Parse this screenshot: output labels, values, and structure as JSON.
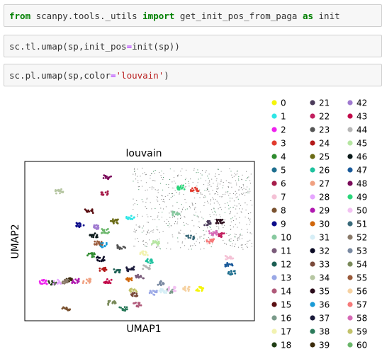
{
  "cells": [
    {
      "id": "cell-1",
      "tokens": [
        {
          "t": "from",
          "c": "kw"
        },
        {
          "t": " scanpy.tools._utils ",
          "c": ""
        },
        {
          "t": "import",
          "c": "kw"
        },
        {
          "t": " get_init_pos_from_paga ",
          "c": ""
        },
        {
          "t": "as",
          "c": "kw"
        },
        {
          "t": " init",
          "c": ""
        }
      ]
    },
    {
      "id": "cell-2",
      "tokens": [
        {
          "t": "sc.tl.umap(sp,init_pos",
          "c": ""
        },
        {
          "t": "=",
          "c": "eq"
        },
        {
          "t": "init(sp))",
          "c": ""
        }
      ]
    },
    {
      "id": "cell-3",
      "tokens": [
        {
          "t": "sc.pl.umap(sp,color",
          "c": ""
        },
        {
          "t": "=",
          "c": "eq"
        },
        {
          "t": "'louvain'",
          "c": "str"
        },
        {
          "t": ")",
          "c": ""
        }
      ]
    }
  ],
  "chart_data": {
    "type": "scatter",
    "title": "louvain",
    "xlabel": "UMAP1",
    "ylabel": "UMAP2",
    "grid": false,
    "legend_placement": "right",
    "legend": [
      {
        "label": "0",
        "color": "#f5f50a"
      },
      {
        "label": "1",
        "color": "#2ee6e6"
      },
      {
        "label": "2",
        "color": "#ee22ee"
      },
      {
        "label": "3",
        "color": "#e23b2e"
      },
      {
        "label": "4",
        "color": "#2e8b2e"
      },
      {
        "label": "5",
        "color": "#1f6f8f"
      },
      {
        "label": "6",
        "color": "#a61c4a"
      },
      {
        "label": "7",
        "color": "#f4c2d6"
      },
      {
        "label": "8",
        "color": "#7a5230"
      },
      {
        "label": "9",
        "color": "#0c0c8a"
      },
      {
        "label": "10",
        "color": "#88c9a0"
      },
      {
        "label": "11",
        "color": "#7a5b7a"
      },
      {
        "label": "12",
        "color": "#1b5e52"
      },
      {
        "label": "13",
        "color": "#9aa8e6"
      },
      {
        "label": "14",
        "color": "#b05a7a"
      },
      {
        "label": "15",
        "color": "#5a0f12"
      },
      {
        "label": "16",
        "color": "#7a9a8a"
      },
      {
        "label": "17",
        "color": "#f2f2b0"
      },
      {
        "label": "18",
        "color": "#1f3d14"
      },
      {
        "label": "21",
        "color": "#4a3a5a"
      },
      {
        "label": "22",
        "color": "#c21f5f"
      },
      {
        "label": "23",
        "color": "#555555"
      },
      {
        "label": "24",
        "color": "#b31919"
      },
      {
        "label": "25",
        "color": "#6a6a14"
      },
      {
        "label": "26",
        "color": "#1fc29f"
      },
      {
        "label": "27",
        "color": "#f0a080"
      },
      {
        "label": "28",
        "color": "#e6a6ff"
      },
      {
        "label": "29",
        "color": "#b018b0"
      },
      {
        "label": "30",
        "color": "#d0660a"
      },
      {
        "label": "31",
        "color": "#d6eef6"
      },
      {
        "label": "32",
        "color": "#0a0a24"
      },
      {
        "label": "33",
        "color": "#7a4a3a"
      },
      {
        "label": "34",
        "color": "#b6c6a2"
      },
      {
        "label": "35",
        "color": "#2a0a1a"
      },
      {
        "label": "36",
        "color": "#189ad6"
      },
      {
        "label": "37",
        "color": "#1a1a3a"
      },
      {
        "label": "38",
        "color": "#2a7a5a"
      },
      {
        "label": "39",
        "color": "#3a2a0a"
      },
      {
        "label": "42",
        "color": "#a07ad0"
      },
      {
        "label": "43",
        "color": "#c20a4a"
      },
      {
        "label": "44",
        "color": "#b6b6b6"
      },
      {
        "label": "45",
        "color": "#b6e6a2"
      },
      {
        "label": "46",
        "color": "#0a1a1a"
      },
      {
        "label": "47",
        "color": "#1a5a9a"
      },
      {
        "label": "48",
        "color": "#7a0a5a"
      },
      {
        "label": "49",
        "color": "#2ad67a"
      },
      {
        "label": "50",
        "color": "#f2c2f2"
      },
      {
        "label": "51",
        "color": "#3a6a7a"
      },
      {
        "label": "52",
        "color": "#8a7a6a"
      },
      {
        "label": "53",
        "color": "#7a8aa2"
      },
      {
        "label": "54",
        "color": "#7a8a5a"
      },
      {
        "label": "55",
        "color": "#9a5a3a"
      },
      {
        "label": "56",
        "color": "#f6d2a2"
      },
      {
        "label": "57",
        "color": "#f67a7a"
      },
      {
        "label": "58",
        "color": "#d66ab6"
      },
      {
        "label": "59",
        "color": "#c2c26a"
      },
      {
        "label": "60",
        "color": "#6ab66a"
      }
    ],
    "clusters": [
      {
        "label": "0",
        "x": 7.6,
        "y": 1.6
      },
      {
        "label": "1",
        "x": 4.6,
        "y": 5.2
      },
      {
        "label": "2",
        "x": 0.8,
        "y": 1.95
      },
      {
        "label": "3",
        "x": 7.4,
        "y": 6.6
      },
      {
        "label": "4",
        "x": 2.9,
        "y": 3.3
      },
      {
        "label": "5",
        "x": 9.0,
        "y": 2.4
      },
      {
        "label": "6",
        "x": 3.5,
        "y": 6.4
      },
      {
        "label": "7",
        "x": 8.9,
        "y": 3.2
      },
      {
        "label": "8",
        "x": 1.8,
        "y": 0.6
      },
      {
        "label": "9",
        "x": 2.4,
        "y": 4.8
      },
      {
        "label": "10",
        "x": 6.6,
        "y": 5.4
      },
      {
        "label": "11",
        "x": 5.0,
        "y": 2.2
      },
      {
        "label": "12",
        "x": 4.0,
        "y": 2.5
      },
      {
        "label": "13",
        "x": 5.6,
        "y": 1.4
      },
      {
        "label": "14",
        "x": 4.9,
        "y": 0.8
      },
      {
        "label": "15",
        "x": 2.8,
        "y": 5.5
      },
      {
        "label": "16",
        "x": 6.3,
        "y": 1.5
      },
      {
        "label": "17",
        "x": 5.2,
        "y": 3.4
      },
      {
        "label": "18",
        "x": 1.2,
        "y": 1.9
      },
      {
        "label": "21",
        "x": 8.0,
        "y": 4.9
      },
      {
        "label": "22",
        "x": 8.6,
        "y": 4.3
      },
      {
        "label": "23",
        "x": 4.2,
        "y": 3.7
      },
      {
        "label": "24",
        "x": 3.4,
        "y": 2.6
      },
      {
        "label": "25",
        "x": 3.9,
        "y": 5.0
      },
      {
        "label": "26",
        "x": 5.4,
        "y": 3.0
      },
      {
        "label": "27",
        "x": 2.7,
        "y": 2.0
      },
      {
        "label": "28",
        "x": 1.4,
        "y": 1.95
      },
      {
        "label": "29",
        "x": 2.2,
        "y": 2.0
      },
      {
        "label": "30",
        "x": 4.5,
        "y": 2.1
      },
      {
        "label": "31",
        "x": 6.0,
        "y": 1.5
      },
      {
        "label": "32",
        "x": 3.3,
        "y": 3.1
      },
      {
        "label": "33",
        "x": 4.8,
        "y": 1.3
      },
      {
        "label": "34",
        "x": 1.5,
        "y": 6.5
      },
      {
        "label": "35",
        "x": 8.5,
        "y": 5.0
      },
      {
        "label": "36",
        "x": 3.4,
        "y": 3.8
      },
      {
        "label": "37",
        "x": 4.6,
        "y": 2.6
      },
      {
        "label": "38",
        "x": 4.3,
        "y": 0.6
      },
      {
        "label": "39",
        "x": 1.9,
        "y": 2.05
      },
      {
        "label": "42",
        "x": 3.1,
        "y": 4.7
      },
      {
        "label": "43",
        "x": 3.6,
        "y": 2.0
      },
      {
        "label": "44",
        "x": 5.3,
        "y": 2.7
      },
      {
        "label": "45",
        "x": 5.7,
        "y": 3.9
      },
      {
        "label": "46",
        "x": 3.0,
        "y": 4.3
      },
      {
        "label": "47",
        "x": 8.9,
        "y": 2.8
      },
      {
        "label": "48",
        "x": 3.6,
        "y": 7.2
      },
      {
        "label": "49",
        "x": 6.8,
        "y": 6.7
      },
      {
        "label": "50",
        "x": 6.4,
        "y": 1.6
      },
      {
        "label": "51",
        "x": 7.2,
        "y": 4.2
      },
      {
        "label": "52",
        "x": 1.8,
        "y": 1.95
      },
      {
        "label": "53",
        "x": 5.9,
        "y": 1.9
      },
      {
        "label": "54",
        "x": 3.8,
        "y": 0.9
      },
      {
        "label": "55",
        "x": 3.2,
        "y": 3.9
      },
      {
        "label": "56",
        "x": 7.0,
        "y": 1.6
      },
      {
        "label": "57",
        "x": 8.1,
        "y": 4.0
      },
      {
        "label": "58",
        "x": 8.2,
        "y": 4.4
      },
      {
        "label": "59",
        "x": 4.7,
        "y": 1.5
      },
      {
        "label": "60",
        "x": 3.5,
        "y": 4.5
      }
    ]
  }
}
